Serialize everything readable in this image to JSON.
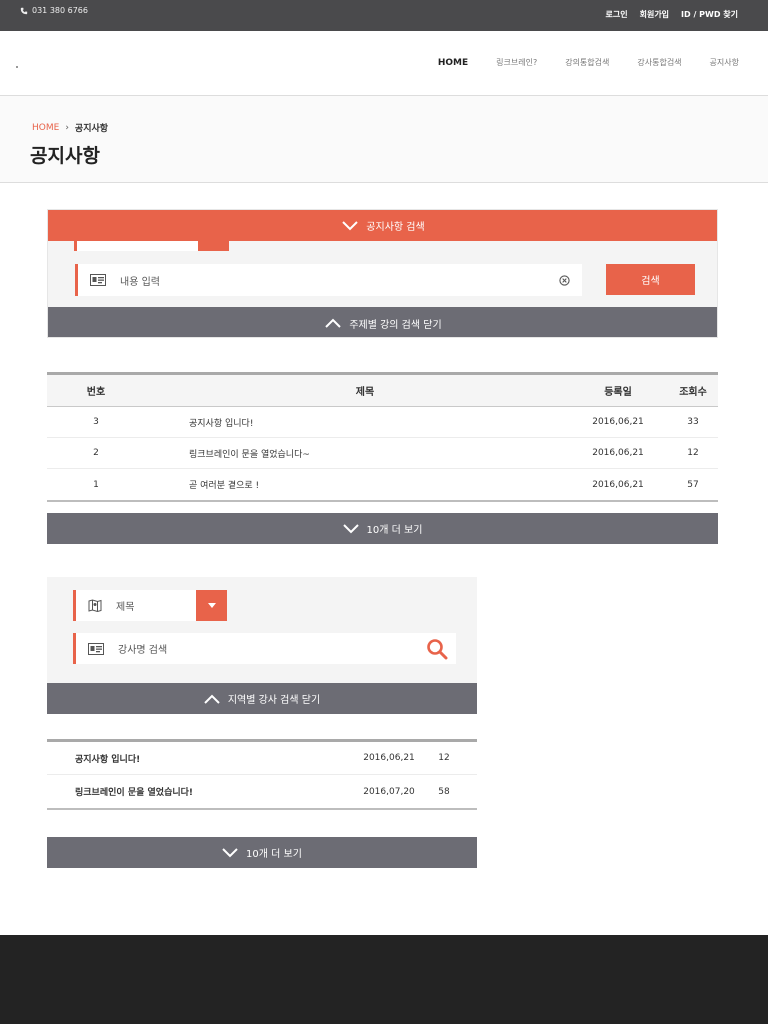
{
  "topbar": {
    "phone": "031 380 6766",
    "links": [
      "로그인",
      "회원가입",
      "ID / PWD 찾기"
    ]
  },
  "nav": {
    "items": [
      "HOME",
      "링크브레인?",
      "강의통합검색",
      "강사통합검색",
      "공지사항"
    ]
  },
  "breadcrumb": {
    "home": "HOME",
    "current": "공지사항"
  },
  "page_title": "공지사항",
  "search1": {
    "toggle_label": "공지사항 검색",
    "input_placeholder": "내용 입력",
    "search_button": "검색",
    "close_label": "주제별 강의 검색 닫기"
  },
  "table1": {
    "headers": [
      "번호",
      "제목",
      "등록일",
      "조회수"
    ],
    "rows": [
      {
        "no": "3",
        "title": "공지사항 입니다!",
        "date": "2016,06,21",
        "views": "33"
      },
      {
        "no": "2",
        "title": "링크브레인이 문을 열었습니다~",
        "date": "2016,06,21",
        "views": "12"
      },
      {
        "no": "1",
        "title": "곧 여러분 곁으로 !",
        "date": "2016,06,21",
        "views": "57"
      }
    ],
    "more_label": "10개 더 보기"
  },
  "search2": {
    "select_value": "제목",
    "input_placeholder": "강사명 검색",
    "close_label": "지역별 강사 검색 닫기"
  },
  "table2": {
    "rows": [
      {
        "title": "공지사항 입니다!",
        "date": "2016,06,21",
        "views": "12"
      },
      {
        "title": "링크브레인이 문을 열었습니다!",
        "date": "2016,07,20",
        "views": "58"
      }
    ],
    "more_label": "10개 더 보기"
  },
  "colors": {
    "accent": "#e8634a",
    "bar_gray": "#6c6c74",
    "topbar": "#4a4a4c",
    "footer": "#232323"
  }
}
